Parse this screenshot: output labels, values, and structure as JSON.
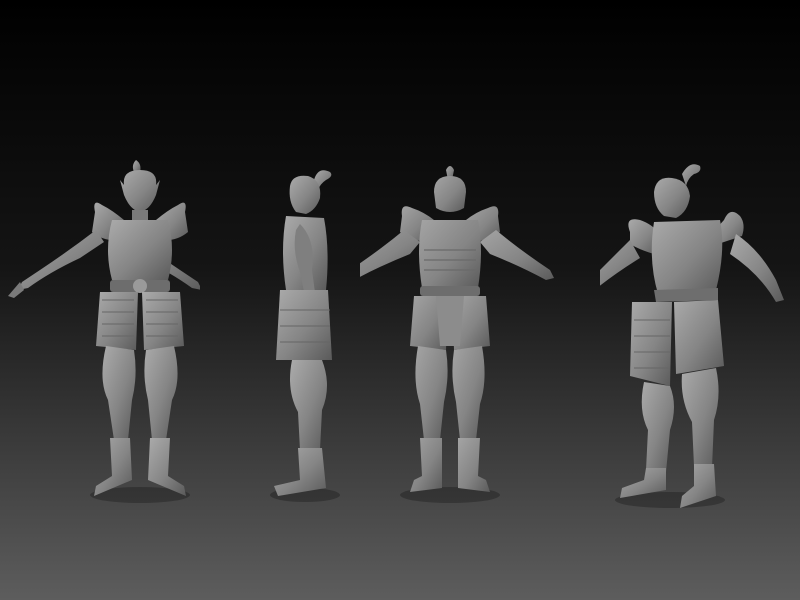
{
  "scene": {
    "description_visible_text": "",
    "background": {
      "top_color": "#000000",
      "bottom_color": "#5d5d5d"
    },
    "model_color": "#8e8e8e",
    "model_shadow": "#4a4a4a",
    "model_highlight": "#b4b4b4",
    "views": [
      "front",
      "side",
      "back",
      "three-quarter"
    ]
  }
}
